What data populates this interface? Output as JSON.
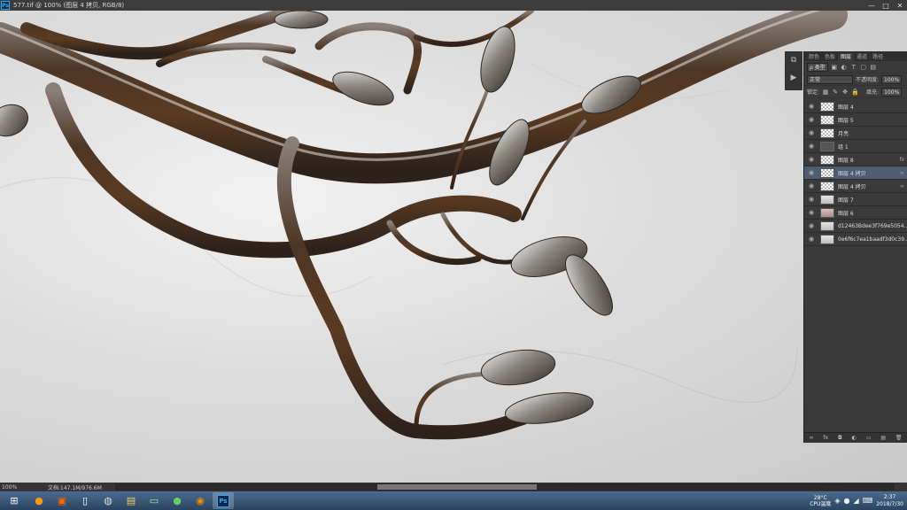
{
  "titlebar": {
    "app_badge": "Ps",
    "title": "577.tif @ 100% (图层 4 拷贝, RGB/8)",
    "minimize": "—",
    "maximize": "□",
    "close": "✕"
  },
  "layers_panel": {
    "tabs": [
      {
        "label": "颜色"
      },
      {
        "label": "色板"
      },
      {
        "label": "图层",
        "active": true
      },
      {
        "label": "通道"
      },
      {
        "label": "路径"
      }
    ],
    "filter_label": "ρ 类型",
    "blend_mode": "正常",
    "opacity_label": "不透明度:",
    "opacity_value": "100%",
    "lock_label": "锁定:",
    "fill_label": "填充:",
    "fill_value": "100%",
    "layers": [
      {
        "name": "图层 4",
        "thumb": "checker"
      },
      {
        "name": "图层 5",
        "thumb": "checker"
      },
      {
        "name": "月亮",
        "thumb": "checker"
      },
      {
        "name": "组 1",
        "thumb": "checker"
      },
      {
        "name": "图层 8",
        "thumb": "checker",
        "badge": "fx"
      },
      {
        "name": "图层 4 拷贝",
        "thumb": "checker",
        "badge": "∞",
        "selected": true
      },
      {
        "name": "图层 4 拷贝",
        "thumb": "checker",
        "badge": "∞"
      },
      {
        "name": "图层 7",
        "thumb": "photo"
      },
      {
        "name": "图层 6",
        "thumb": "photo2"
      },
      {
        "name": "d12463Bdee3f769e5054...",
        "thumb": "photo"
      },
      {
        "name": "0e6f6c7ea1baadf3d0c39...",
        "thumb": "photo"
      }
    ],
    "footer_icons": [
      "∞",
      "fx",
      "◘",
      "◐",
      "▭",
      "▤",
      "🗑"
    ]
  },
  "statusbar": {
    "zoom": "100%",
    "doc": "文档:147.1M/976.6M"
  },
  "taskbar": {
    "tray_temp_value": "28°C",
    "tray_temp_label": "CPU温度",
    "clock_time": "2:37",
    "clock_date": "2018/7/30"
  }
}
